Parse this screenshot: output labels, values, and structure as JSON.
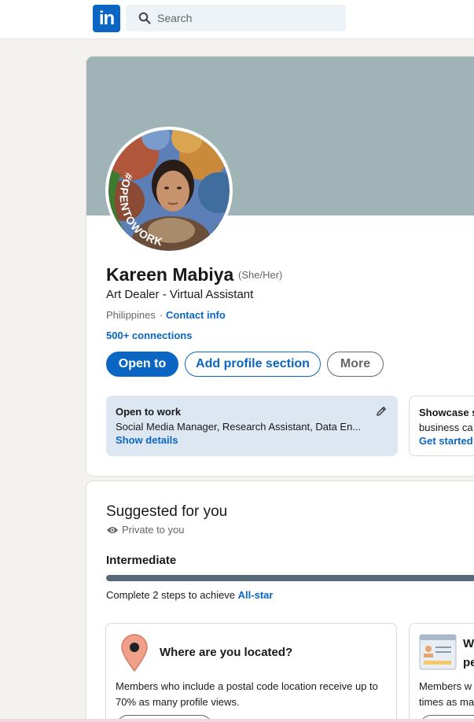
{
  "header": {
    "logo_text": "in",
    "search_placeholder": "Search"
  },
  "profile": {
    "name": "Kareen Mabiya",
    "pronouns": "(She/Her)",
    "headline": "Art Dealer - Virtual Assistant",
    "location": "Philippines",
    "separator": "·",
    "contact_info_label": "Contact info",
    "connections": "500+ connections",
    "frame_text": "#OPENTOWORK",
    "buttons": {
      "open_to": "Open to",
      "add_section": "Add profile section",
      "more": "More"
    },
    "open_to_work": {
      "title": "Open to work",
      "roles": "Social Media Manager, Research Assistant, Data En...",
      "link": "Show details"
    },
    "showcase": {
      "title": "Showcase s",
      "text": "business ca",
      "link": "Get started"
    }
  },
  "suggested": {
    "title": "Suggested for you",
    "privacy": "Private to you",
    "level": "Intermediate",
    "progress_fraction": 1.0,
    "steps_text": "Complete 2 steps to achieve ",
    "steps_link": "All-star",
    "cards": [
      {
        "title": "Where are you located?",
        "text": "Members who include a postal code location receive up to 70% as many profile views."
      },
      {
        "title_line1": "W",
        "title_line2": "pe",
        "text_line1": "Members w",
        "text_line2": "times as ma"
      }
    ]
  },
  "colors": {
    "brand_blue": "#0a66c2",
    "cover": "#a0b4b7",
    "opentowork_green": "#3e7a2f",
    "page_bg": "#f3f2ef"
  }
}
